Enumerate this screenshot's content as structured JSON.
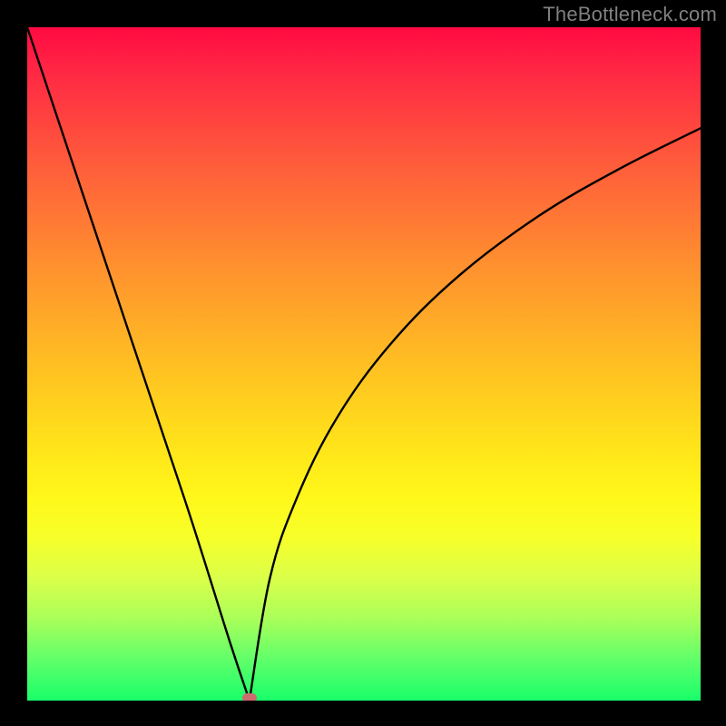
{
  "attribution": "TheBottleneck.com",
  "colors": {
    "frame_bg": "#000000",
    "curve_stroke": "#000000",
    "marker_fill": "#cd6b6f",
    "attribution_text": "#808080",
    "gradient_top": "#ff0a42",
    "gradient_bottom": "#18ff6a"
  },
  "chart_data": {
    "type": "line",
    "title": "",
    "xlabel": "",
    "ylabel": "",
    "xlim": [
      0,
      100
    ],
    "ylim": [
      0,
      100
    ],
    "grid": false,
    "note": "V-shaped bottleneck curve over a vertical red→green gradient. Curve drops steeply from top-left to a cusp near x≈33 at y≈0, then rises with a concave sqrt-like arc toward upper-right (~y≈85 at x=100). A small rounded marker sits at the cusp (optimal point).",
    "series": [
      {
        "name": "left-branch",
        "x": [
          0,
          8,
          16,
          24,
          30,
          33
        ],
        "values": [
          100,
          76,
          52,
          28,
          9,
          0
        ]
      },
      {
        "name": "right-branch",
        "x": [
          33,
          36,
          40,
          46,
          54,
          64,
          76,
          88,
          100
        ],
        "values": [
          0,
          18,
          30,
          42,
          53,
          63,
          72,
          79,
          85
        ]
      }
    ],
    "marker": {
      "x": 33,
      "y": 0
    }
  }
}
